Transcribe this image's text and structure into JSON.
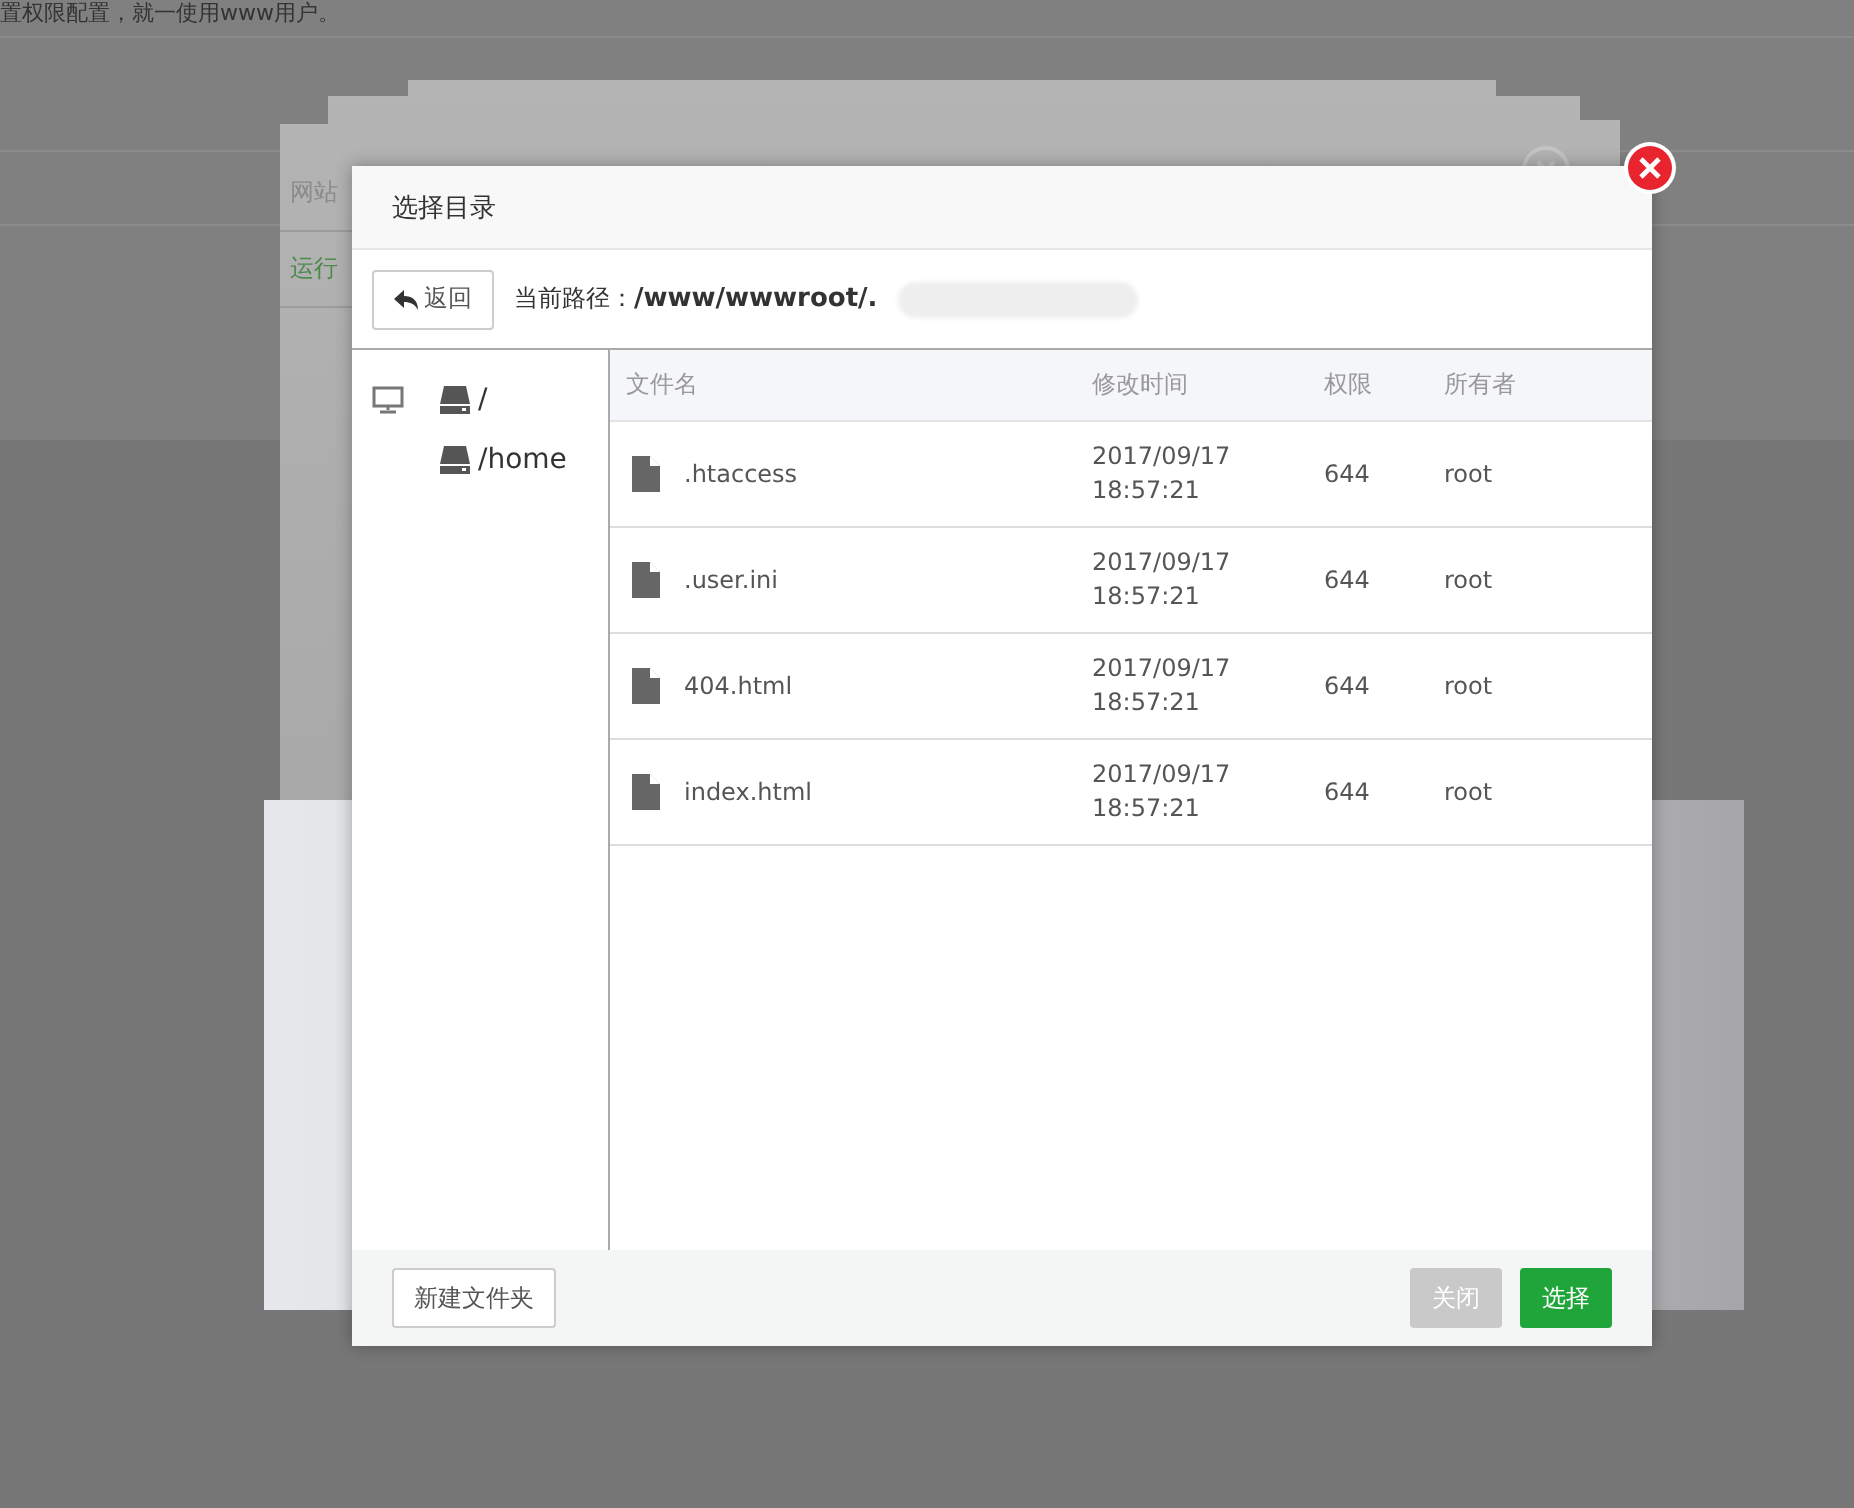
{
  "page": {
    "notice": "置权限配置，就一使用www用户。",
    "rows": [
      {
        "text": "网站",
        "kind": "label"
      },
      {
        "text": "运行",
        "kind": "status"
      }
    ]
  },
  "dialog": {
    "title": "选择目录",
    "back_button": "返回",
    "path_label": "当前路径：",
    "path": "/www/wwwroot/.",
    "tree": [
      {
        "label": "/"
      },
      {
        "label": "/home"
      }
    ],
    "columns": [
      "文件名",
      "修改时间",
      "权限",
      "所有者"
    ],
    "files": [
      {
        "name": ".htaccess",
        "modified": "2017/09/17 18:57:21",
        "permission": "644",
        "owner": "root"
      },
      {
        "name": ".user.ini",
        "modified": "2017/09/17 18:57:21",
        "permission": "644",
        "owner": "root"
      },
      {
        "name": "404.html",
        "modified": "2017/09/17 18:57:21",
        "permission": "644",
        "owner": "root"
      },
      {
        "name": "index.html",
        "modified": "2017/09/17 18:57:21",
        "permission": "644",
        "owner": "root"
      }
    ],
    "new_folder_button": "新建文件夹",
    "buttons": [
      {
        "label": "关闭",
        "disabled": true
      },
      {
        "label": "选择",
        "disabled": false
      }
    ]
  }
}
